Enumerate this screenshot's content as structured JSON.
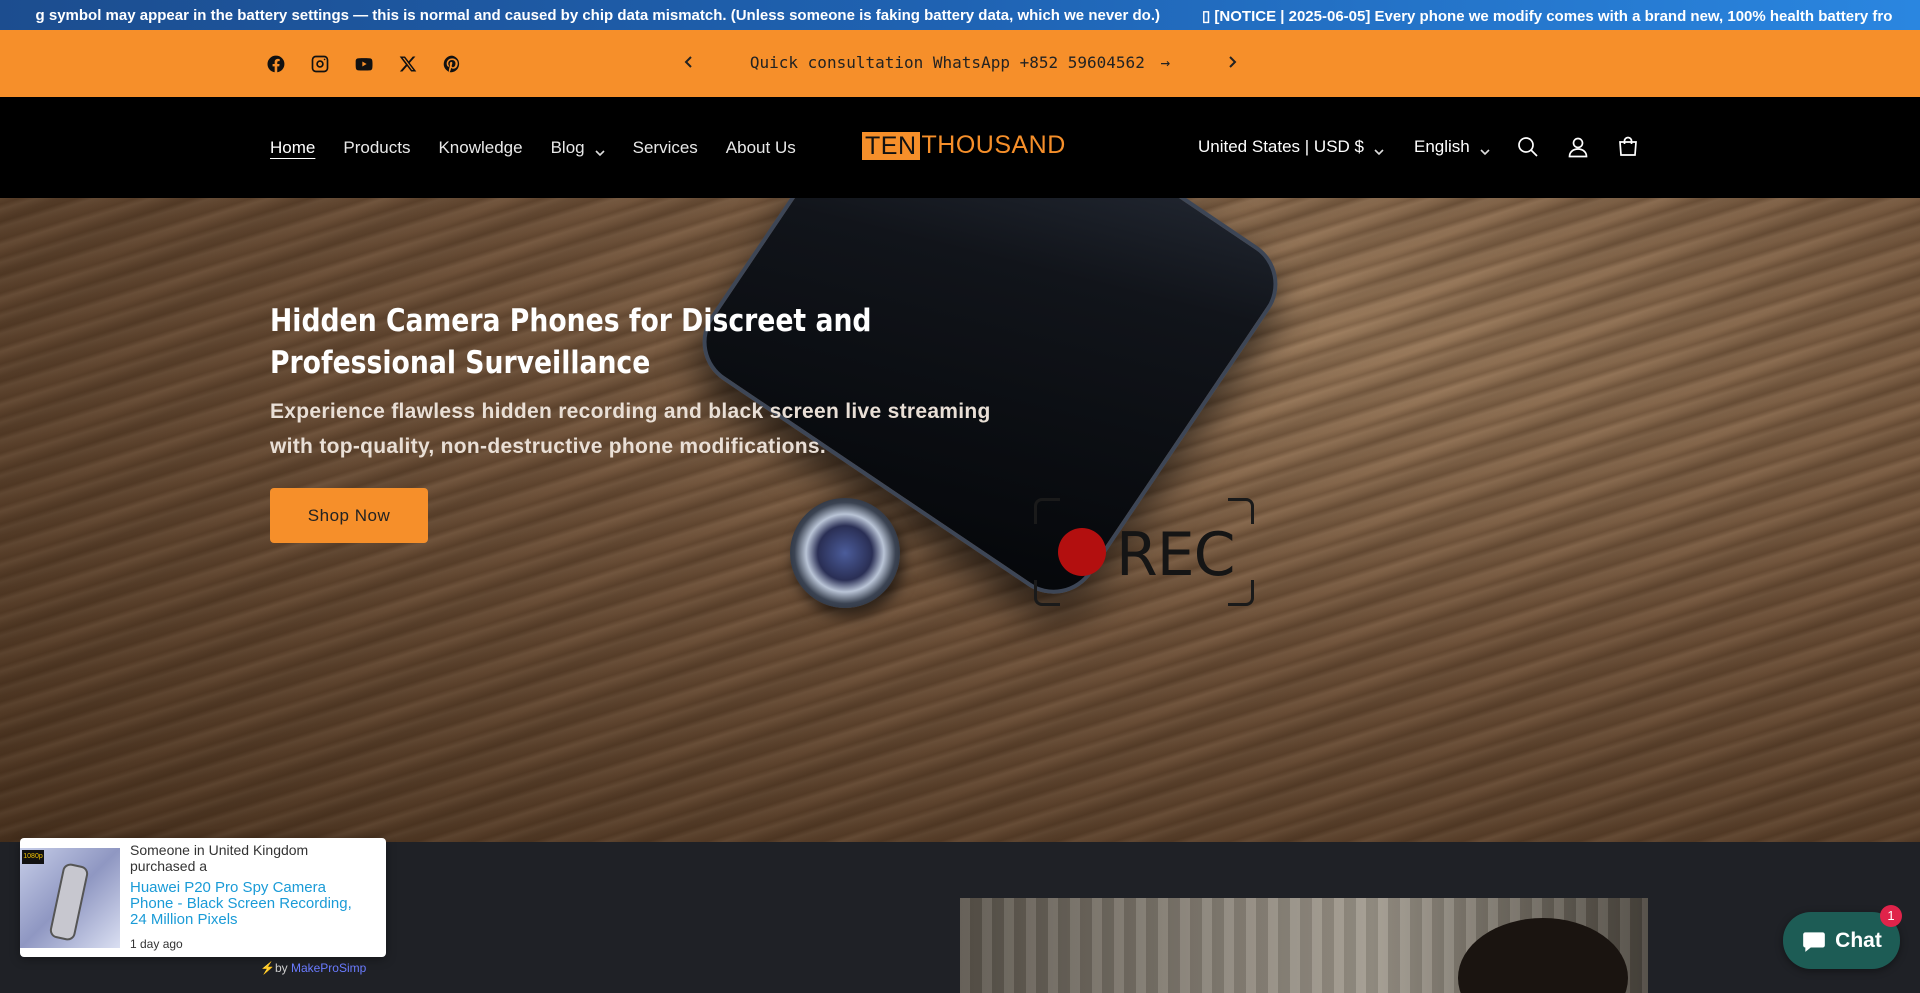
{
  "ticker": {
    "item1": "g symbol may appear in the battery settings — this is normal and caused by chip data mismatch. (Unless someone is faking battery data, which we never do.)",
    "item2": "▯ [NOTICE | 2025-06-05] Every phone we modify comes with a brand new, 100% health battery fro"
  },
  "announcement": {
    "text": "Quick consultation WhatsApp   +852 59604562",
    "arrow": "→"
  },
  "social_icons": [
    "facebook-icon",
    "instagram-icon",
    "youtube-icon",
    "x-icon",
    "pinterest-icon"
  ],
  "nav": {
    "items": [
      {
        "label": "Home",
        "active": true
      },
      {
        "label": "Products"
      },
      {
        "label": "Knowledge"
      },
      {
        "label": "Blog",
        "dropdown": true
      },
      {
        "label": "Services"
      },
      {
        "label": "About Us"
      }
    ]
  },
  "logo": {
    "box": "TEN",
    "rest": "THOUSAND"
  },
  "locale": {
    "country": "United States | USD $",
    "language": "English"
  },
  "hero": {
    "title": "Hidden Camera Phones for Discreet and Professional Surveillance",
    "subtitle": "Experience flawless hidden recording and black screen live streaming with top-quality, non-destructive phone modifications.",
    "button": "Shop Now",
    "rec_label": "REC"
  },
  "popup": {
    "line1": "Someone in United Kingdom purchased a",
    "product": "Huawei P20 Pro Spy Camera Phone - Black Screen Recording, 24 Million Pixels",
    "time": "1 day ago",
    "thumb_badge": "1080p",
    "by_prefix": "⚡by ",
    "by_brand": "MakeProSimp"
  },
  "chat": {
    "label": "Chat",
    "badge": "1"
  },
  "colors": {
    "accent": "#f68f2a",
    "header_bg": "#000000",
    "link": "#1a9bd7",
    "chat": "#1d5c55"
  }
}
